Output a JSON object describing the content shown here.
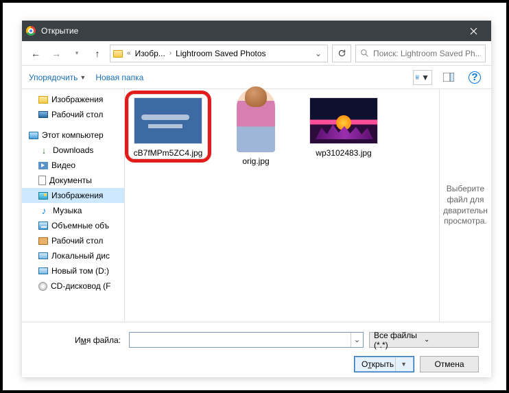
{
  "title": "Открытие",
  "nav": {
    "crumb1": "Изобр...",
    "crumb2": "Lightroom Saved Photos",
    "search_placeholder": "Поиск: Lightroom Saved Ph..."
  },
  "toolbar": {
    "organize": "Упорядочить",
    "new_folder": "Новая папка"
  },
  "tree": [
    {
      "label": "Изображения",
      "icon": "ico-folder",
      "depth": 2
    },
    {
      "label": "Рабочий стол",
      "icon": "ico-desktop",
      "depth": 2
    },
    {
      "label": "Этот компьютер",
      "icon": "ico-thispc",
      "depth": 1,
      "spacer_before": true
    },
    {
      "label": "Downloads",
      "icon": "ico-dl",
      "depth": 2
    },
    {
      "label": "Видео",
      "icon": "ico-video",
      "depth": 2
    },
    {
      "label": "Документы",
      "icon": "ico-doc",
      "depth": 2
    },
    {
      "label": "Изображения",
      "icon": "ico-pics",
      "depth": 2,
      "selected": true
    },
    {
      "label": "Музыка",
      "icon": "ico-music",
      "depth": 2
    },
    {
      "label": "Объемные объ",
      "icon": "ico-vol",
      "depth": 2
    },
    {
      "label": "Рабочий стол",
      "icon": "ico-desk2",
      "depth": 2
    },
    {
      "label": "Локальный дис",
      "icon": "ico-disk",
      "depth": 2
    },
    {
      "label": "Новый том (D:)",
      "icon": "ico-disk",
      "depth": 2
    },
    {
      "label": "CD-дисковод (F",
      "icon": "ico-cd",
      "depth": 2
    }
  ],
  "files": [
    {
      "name": "cB7fMPm5ZC4.jpg",
      "thumb": "bp",
      "highlight": true
    },
    {
      "name": "orig.jpg",
      "thumb": "orig"
    },
    {
      "name": "wp3102483.jpg",
      "thumb": "retro"
    }
  ],
  "preview_hint": "Выберите файл для дварительн просмотра.",
  "footer": {
    "filename_label_pre": "И",
    "filename_label_u": "м",
    "filename_label_post": "я файла:",
    "filename_value": "",
    "filter": "Все файлы (*.*)",
    "open_pre": "О",
    "open_u": "т",
    "open_post": "крыть",
    "cancel": "Отмена"
  }
}
